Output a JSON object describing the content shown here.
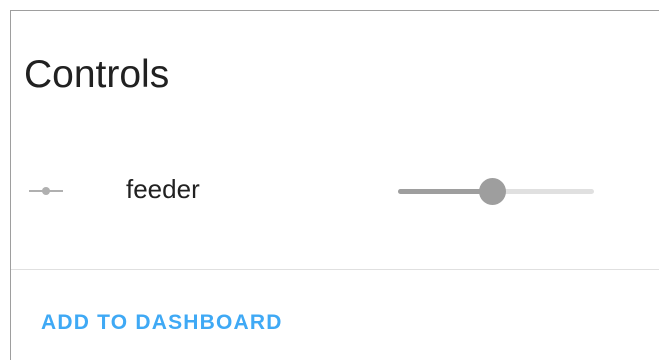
{
  "card": {
    "title": "Controls"
  },
  "controls": [
    {
      "icon": "slider-icon",
      "label": "feeder",
      "value_fraction": 0.48
    }
  ],
  "actions": {
    "add_to_dashboard_label": "ADD TO DASHBOARD"
  },
  "colors": {
    "accent": "#3fa9f5",
    "slider_active": "#9e9e9e",
    "slider_inactive": "#e0e0e0",
    "text": "#212121"
  }
}
